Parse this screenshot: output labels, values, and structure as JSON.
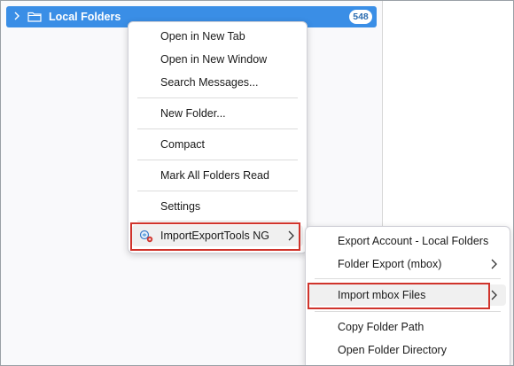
{
  "folder_pane": {
    "account_label": "Local Folders",
    "unread_count": "548"
  },
  "context_menu": {
    "items": [
      {
        "label": "Open in New Tab"
      },
      {
        "label": "Open in New Window"
      },
      {
        "label": "Search Messages..."
      },
      {
        "label": "New Folder..."
      },
      {
        "label": "Compact"
      },
      {
        "label": "Mark All Folders Read"
      },
      {
        "label": "Settings"
      },
      {
        "label": "ImportExportTools NG",
        "icon": "importexport-addon-icon",
        "has_submenu": true
      }
    ]
  },
  "submenu": {
    "items": [
      {
        "label": "Export Account - Local Folders"
      },
      {
        "label": "Folder Export (mbox)",
        "has_submenu": true
      },
      {
        "label": "Import mbox Files",
        "has_submenu": true
      },
      {
        "label": "Copy Folder Path"
      },
      {
        "label": "Open Folder Directory"
      }
    ]
  },
  "colors": {
    "selection_blue": "#3a8ee6",
    "highlight_red": "#d0342c"
  }
}
